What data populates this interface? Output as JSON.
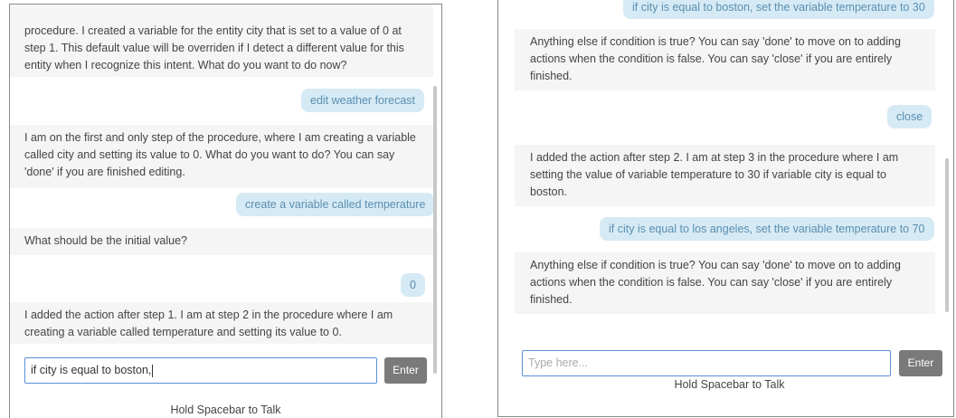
{
  "left_panel": {
    "messages": [
      {
        "role": "bot",
        "text": "procedure. I created a variable for the entity city that is set to a value of 0 at step 1. This default value will be overriden if I detect a different value for this entity when I recognize this intent. What do you want to do now?"
      },
      {
        "role": "user",
        "text": "edit weather forecast"
      },
      {
        "role": "bot",
        "text": "I am on the first and only step of the procedure, where I am creating a variable called city and setting its value to 0. What do you want to do? You can say 'done' if you are finished editing."
      },
      {
        "role": "user",
        "text": "create a variable called temperature"
      },
      {
        "role": "bot",
        "text": "What should be the initial value?"
      },
      {
        "role": "user",
        "text": "0"
      },
      {
        "role": "bot",
        "text": "I added the action after step 1. I am at step 2 in the procedure where I am creating a variable called temperature and setting its value to 0."
      }
    ],
    "input_value": "if city is equal to boston,",
    "enter_label": "Enter",
    "talk_hint": "Hold Spacebar to Talk"
  },
  "right_panel": {
    "messages": [
      {
        "role": "user",
        "text": "if city is equal to boston, set the variable temperature to 30"
      },
      {
        "role": "bot",
        "text": "Anything else if condition is true? You can say 'done' to move on to adding actions when the condition is false. You can say 'close' if you are entirely finished."
      },
      {
        "role": "user",
        "text": "close"
      },
      {
        "role": "bot",
        "text": "I added the action after step 2. I am at step 3 in the procedure where I am setting the value of variable temperature to 30 if variable city is equal to boston."
      },
      {
        "role": "user",
        "text": "if city is equal to los angeles, set the variable temperature to 70"
      },
      {
        "role": "bot",
        "text": "Anything else if condition is true? You can say 'done' to move on to adding actions when the condition is false. You can say 'close' if you are entirely finished."
      }
    ],
    "input_placeholder": "Type here...",
    "enter_label": "Enter",
    "talk_hint": "Hold Spacebar to Talk"
  },
  "colors": {
    "user_bubble_bg": "#d6eaf5",
    "user_bubble_text": "#5a8fb0",
    "bot_bg": "#f5f5f5",
    "enter_button_bg": "#7a7a7a",
    "input_border": "#5b8fd8"
  }
}
